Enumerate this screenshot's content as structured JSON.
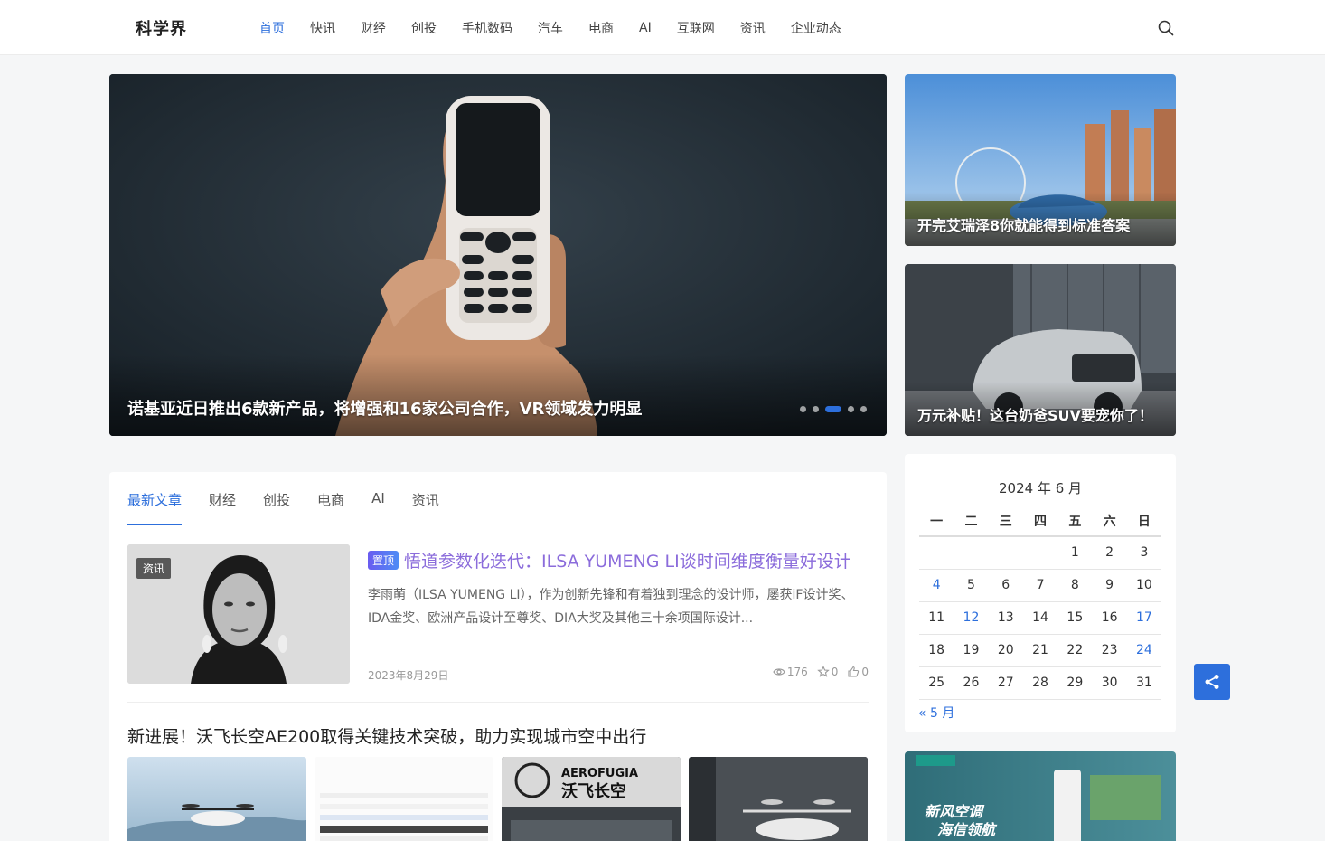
{
  "header": {
    "logo": "科学界",
    "nav": [
      {
        "label": "首页",
        "active": true
      },
      {
        "label": "快讯"
      },
      {
        "label": "财经"
      },
      {
        "label": "创投"
      },
      {
        "label": "手机数码"
      },
      {
        "label": "汽车"
      },
      {
        "label": "电商"
      },
      {
        "label": "AI"
      },
      {
        "label": "互联网"
      },
      {
        "label": "资讯"
      },
      {
        "label": "企业动态"
      }
    ],
    "search_icon": "search-icon"
  },
  "hero": {
    "caption": "诺基亚近日推出6款新产品，将增强和16家公司合作，VR领域发力明显",
    "slide_count": 5,
    "active_slide": 3
  },
  "side_cards": [
    {
      "caption": "开完艾瑞泽8你就能得到标准答案"
    },
    {
      "caption": "万元补贴！这台奶爸SUV要宠你了！"
    }
  ],
  "tabs": [
    "最新文章",
    "财经",
    "创投",
    "电商",
    "AI",
    "资讯"
  ],
  "article": {
    "tag": "资讯",
    "pin": "置顶",
    "title": "悟道参数化迭代：ILSA YUMENG LI谈时间维度衡量好设计",
    "excerpt": "李雨萌（ILSA YUMENG LI），作为创新先锋和有着独到理念的设计师，屡获iF设计奖、IDA金奖、欧洲产品设计至尊奖、DIA大奖及其他三十余项国际设计...",
    "date": "2023年8月29日",
    "views": "176",
    "favorites": "0",
    "likes": "0"
  },
  "article2": {
    "title": "新进展！沃飞长空AE200取得关键技术突破，助力实现城市空中出行",
    "gallery_text": "AEROFUGIA 沃飞长空"
  },
  "calendar": {
    "caption": "2024 年 6 月",
    "weekdays": [
      "一",
      "二",
      "三",
      "四",
      "五",
      "六",
      "日"
    ],
    "weeks": [
      [
        "",
        "",
        "",
        "",
        "1",
        "2",
        "3"
      ],
      [
        "4",
        "5",
        "6",
        "7",
        "8",
        "9",
        "10"
      ],
      [
        "11",
        "12",
        "13",
        "14",
        "15",
        "16",
        "17"
      ],
      [
        "18",
        "19",
        "20",
        "21",
        "22",
        "23",
        "24"
      ],
      [
        "25",
        "26",
        "27",
        "28",
        "29",
        "30",
        "31"
      ]
    ],
    "linked_days": [
      "4",
      "12",
      "17",
      "24"
    ],
    "prev": "« 5 月"
  },
  "ad": {
    "text_line1": "新风空调",
    "text_line2": "海信领航"
  },
  "colors": {
    "accent": "#2d6fdc",
    "title_purple": "#8b6cdb"
  }
}
